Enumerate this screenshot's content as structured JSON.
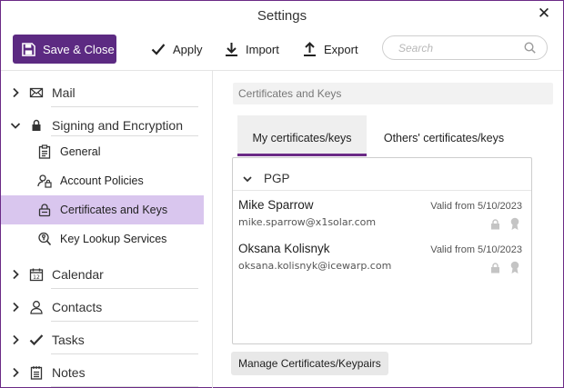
{
  "window": {
    "title": "Settings"
  },
  "toolbar": {
    "save_close": "Save & Close",
    "apply": "Apply",
    "import": "Import",
    "export": "Export",
    "search_placeholder": "Search"
  },
  "sidebar": {
    "mail": "Mail",
    "signing": "Signing and Encryption",
    "signing_items": [
      "General",
      "Account Policies",
      "Certificates and Keys",
      "Key Lookup Services"
    ],
    "calendar": "Calendar",
    "contacts": "Contacts",
    "tasks": "Tasks",
    "notes": "Notes",
    "active_item": "Certificates and Keys"
  },
  "content": {
    "breadcrumb": "Certificates and Keys",
    "tabs": [
      "My certificates/keys",
      "Others' certificates/keys"
    ],
    "active_tab": "My certificates/keys",
    "group": "PGP",
    "certificates": [
      {
        "name": "Mike Sparrow",
        "email": "mike.sparrow@x1solar.com",
        "valid": "Valid from 5/10/2023"
      },
      {
        "name": "Oksana Kolisnyk",
        "email": "oksana.kolisnyk@icewarp.com",
        "valid": "Valid from 5/10/2023"
      }
    ],
    "manage_button": "Manage Certificates/Keypairs"
  },
  "colors": {
    "accent": "#5c2a82",
    "active_bg": "#d9c6ee",
    "border": "#6b2a86"
  }
}
